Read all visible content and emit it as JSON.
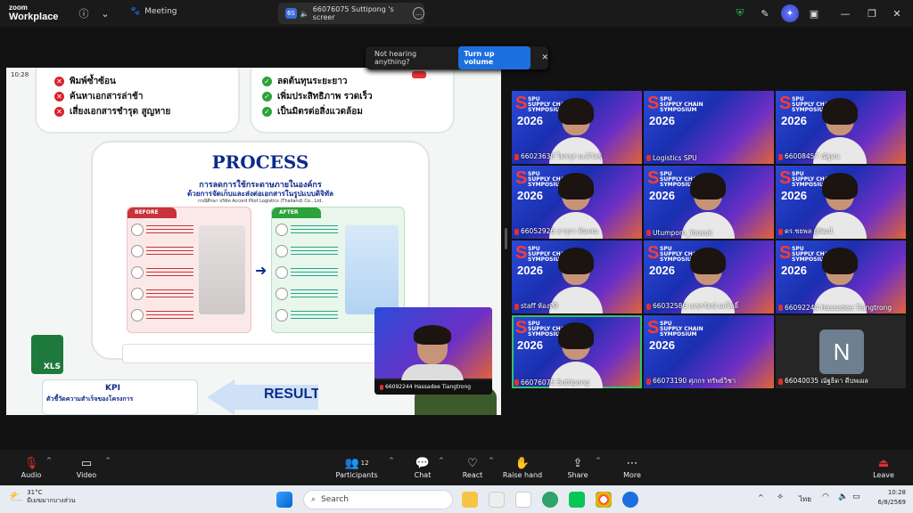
{
  "app": {
    "logo_line1": "zoom",
    "logo_line2": "Workplace",
    "meeting_label": "Meeting"
  },
  "share_tab": {
    "badge": "6S",
    "title": "66076075 Suttipong 's screer"
  },
  "toast": {
    "message": "Not hearing anything?",
    "button": "Turn up volume"
  },
  "slide": {
    "clock": "10:28",
    "problems": [
      "พิมพ์ซ้ำซ้อน",
      "ค้นหาเอกสารล่าช้า",
      "เสี่ยงเอกสารชำรุด สูญหาย"
    ],
    "benefits": [
      "ลดต้นทุนระยะยาว",
      "เพิ่มประสิทธิภาพ รวดเร็ว",
      "เป็นมิตรต่อสิ่งแวดล้อม"
    ],
    "process_title": "PROCESS",
    "process_sub1": "การลดการใช้กระดาษภายในองค์กร",
    "process_sub2": "ด้วยการจัดเก็บและส่งต่อเอกสารในรูปแบบดิจิทัล",
    "process_sub3": "กรณีศึกษา บริษัท Accord Pilot Logistics (Thailand) Co., Ltd.",
    "before_label": "BEFORE",
    "after_label": "AFTER",
    "result_label": "RESULT",
    "kpi_label": "KPI",
    "kpi_sub": "ตัวชี้วัดความสำเร็จของโครงการ",
    "xls": "XLS"
  },
  "selfview": {
    "name": "66092244 Hassadee Tiangtrong"
  },
  "tiles": [
    {
      "name": "66023638 ไตรรุส มะลิวัลย์",
      "type": "person"
    },
    {
      "name": "Logistics SPU",
      "type": "brand"
    },
    {
      "name": "66008457 ณัฐมน",
      "type": "person"
    },
    {
      "name": "66052926 ธารุกา พิมเสน",
      "type": "person"
    },
    {
      "name": "Utumporn_Yoosuk",
      "type": "person"
    },
    {
      "name": "ดร.ชยพล ผู้พัฒน์",
      "type": "person"
    },
    {
      "name": "staff ห้องที่9",
      "type": "person"
    },
    {
      "name": "66032586 เพชรรัตน์ ผลโพธิ์",
      "type": "person"
    },
    {
      "name": "66092244 Hassadee Tiangtrong",
      "type": "person"
    },
    {
      "name": "66076075 Suttipong",
      "type": "person"
    },
    {
      "name": "66073190 ศุภกร ทรัพย์วิชา",
      "type": "brand"
    },
    {
      "name": "66040035 ณัฐธิดา ดีบพเผล",
      "type": "initial",
      "initial": "N"
    }
  ],
  "brand": {
    "line1": "SPU",
    "line2": "SUPPLY CHAIN",
    "line3": "SYMPOSIUM",
    "year": "2026"
  },
  "controls": {
    "audio": "Audio",
    "video": "Video",
    "participants": "Participants",
    "participants_count": "12",
    "chat": "Chat",
    "react": "React",
    "raise_hand": "Raise hand",
    "share": "Share",
    "more": "More",
    "leave": "Leave"
  },
  "taskbar": {
    "temp": "31°C",
    "weather": "มีเมฆมากบางส่วน",
    "search": "Search",
    "lang": "ไทย",
    "time": "10:28",
    "date": "6/8/2569"
  },
  "colors": {
    "accent": "#1d6fe0",
    "active_tile": "#33c26a",
    "problem": "#d9232b",
    "benefit": "#2ba23a"
  }
}
